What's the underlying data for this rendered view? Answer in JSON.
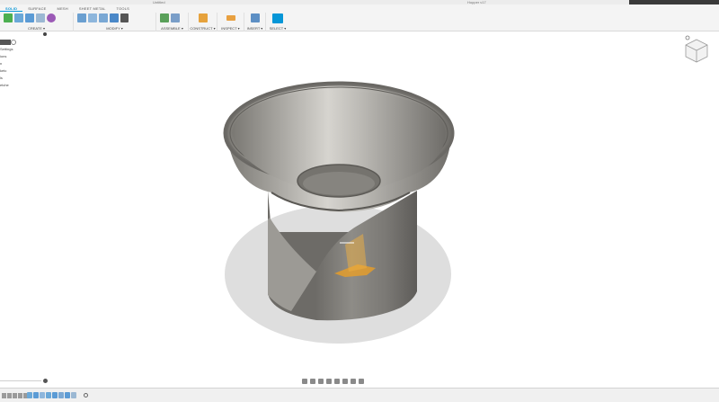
{
  "window": {
    "tab_title": "Untitled",
    "document_title": "Hopper v17"
  },
  "toolbar": {
    "tabs": [
      {
        "label": "SOLID",
        "active": true
      },
      {
        "label": "SURFACE",
        "active": false
      },
      {
        "label": "MESH",
        "active": false
      },
      {
        "label": "SHEET METAL",
        "active": false
      },
      {
        "label": "TOOLS",
        "active": false
      }
    ],
    "groups": {
      "create": {
        "label": "CREATE ▾",
        "icons": [
          "new-component-icon",
          "create-sketch-icon",
          "extrude-icon",
          "revolve-icon",
          "form-icon"
        ]
      },
      "modify": {
        "label": "MODIFY ▾",
        "icons": [
          "press-pull-icon",
          "fillet-icon",
          "shell-icon",
          "combine-icon",
          "move-icon"
        ]
      },
      "assemble": {
        "label": "ASSEMBLE ▾",
        "icons": [
          "new-component-icon",
          "joint-icon"
        ]
      },
      "construct": {
        "label": "CONSTRUCT ▾",
        "icons": [
          "offset-plane-icon"
        ]
      },
      "inspect": {
        "label": "INSPECT ▾",
        "icons": [
          "measure-icon"
        ]
      },
      "insert": {
        "label": "INSERT ▾",
        "icons": [
          "insert-image-icon"
        ]
      },
      "select": {
        "label": "SELECT ▾",
        "icons": [
          "select-arrow-icon"
        ]
      }
    }
  },
  "browser": {
    "items": [
      "Settings",
      "ions",
      "n",
      "ketc",
      "ls",
      "etche"
    ]
  },
  "colors": {
    "accent": "#0696d7",
    "model_body": "#8d8b86",
    "highlight": "#f0a020",
    "ground_shadow": "#dedede"
  }
}
